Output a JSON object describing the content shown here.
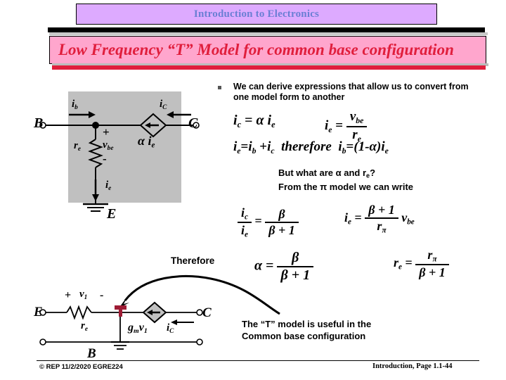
{
  "header": {
    "title": "Introduction to Electronics",
    "banner": "Low Frequency “T” Model for common base configuration",
    "title_bg": "#ddaaff",
    "title_fg": "#6a7fd4",
    "banner_bg": "#ffa6cd",
    "banner_fg": "#e01e3c"
  },
  "bullet": {
    "marker": "square-bullet",
    "text": "We can derive expressions that allow us to convert from one model form to another"
  },
  "equations": {
    "ic_eq": {
      "lhs": "i",
      "lhs_sub": "c",
      "op": "=",
      "alpha": "α",
      "rhs": "i",
      "rhs_sub": "e"
    },
    "ie_eq": {
      "lhs": "i",
      "lhs_sub": "e",
      "op": "=",
      "num": "v",
      "num_sub": "be",
      "den": "r",
      "den_sub": "e"
    },
    "kcl_line": "iₑ=iᵇ +iᶜ  therefore  iᵇ= (1-α)iₑ",
    "kcl_parts": {
      "ie": "i",
      "ie_sub": "e",
      "eq": "=",
      "ib": "i",
      "ib_sub": "b",
      "plus": "+",
      "ic": "i",
      "ic_sub": "c",
      "therefore": "therefore",
      "ib2": "i",
      "ib2_sub": "b",
      "eq2": "=",
      "expr": "(1-",
      "alpha": "α",
      "expr_end": ")",
      "ie2": "i",
      "ie2_sub": "e"
    },
    "question": "But what are α and rₑ?\nFrom the π model we can write",
    "question_line1_a": "But what are ",
    "question_line1_alpha": "α",
    "question_line1_b": " and r",
    "question_line1_sub": "e",
    "question_line1_c": "?",
    "question_line2_a": "From the ",
    "question_line2_pi": "π",
    "question_line2_b": " model we can write",
    "ratio_eq": {
      "num_lhs": "i",
      "num_lhs_sub": "c",
      "den_lhs": "i",
      "den_lhs_sub": "e",
      "op": "=",
      "num_rhs": "β",
      "den_rhs": "β + 1"
    },
    "ie_beta_eq": {
      "lhs": "i",
      "lhs_sub": "e",
      "op": "=",
      "num": "β + 1",
      "den": "r",
      "den_sub": "π",
      "tail": "v",
      "tail_sub": "be"
    },
    "alpha_eq": {
      "lhs": "α",
      "op": "=",
      "num": "β",
      "den": "β + 1"
    },
    "re_eq": {
      "lhs": "r",
      "lhs_sub": "e",
      "op": "=",
      "num": "r",
      "num_sub": "π",
      "den": "β + 1"
    },
    "therefore_label": "Therefore"
  },
  "circuit_top": {
    "name": "common-base-T-model-top",
    "terminal_B": "B",
    "terminal_C": "C",
    "terminal_E": "E",
    "label_ib": "i",
    "label_ib_sub": "b",
    "label_iC": "i",
    "label_iC_sub": "C",
    "label_re": "r",
    "label_re_sub": "e",
    "label_vbe": "v",
    "label_vbe_sub": "be",
    "label_plus": "+",
    "label_minus": "-",
    "label_ie": "i",
    "label_ie_sub": "e",
    "source_alpha": "α",
    "source_ie": "i",
    "source_ie_sub": "e",
    "box_color": "#c0c0c0"
  },
  "circuit_bottom": {
    "name": "pi-model-bottom",
    "terminal_E": "E",
    "terminal_C": "C",
    "terminal_B": "B",
    "label_plus": "+",
    "label_minus": "-",
    "label_v1": "v",
    "label_v1_sub": "1",
    "label_re": "r",
    "label_re_sub": "e",
    "label_gm": "g",
    "label_gm_sub": "m",
    "label_gmv1": "v",
    "label_gmv1_sub": "1",
    "label_ic": "i",
    "label_ic_sub": "C",
    "marker_color": "#9e1b34",
    "diamond_color": "#c0c0c0"
  },
  "note": {
    "line1": "The “T” model is useful in the",
    "line2": "Common base configuration"
  },
  "footer": {
    "left": "© REP  11/2/2020  EGRE224",
    "right": "Introduction, Page 1.1-44"
  }
}
